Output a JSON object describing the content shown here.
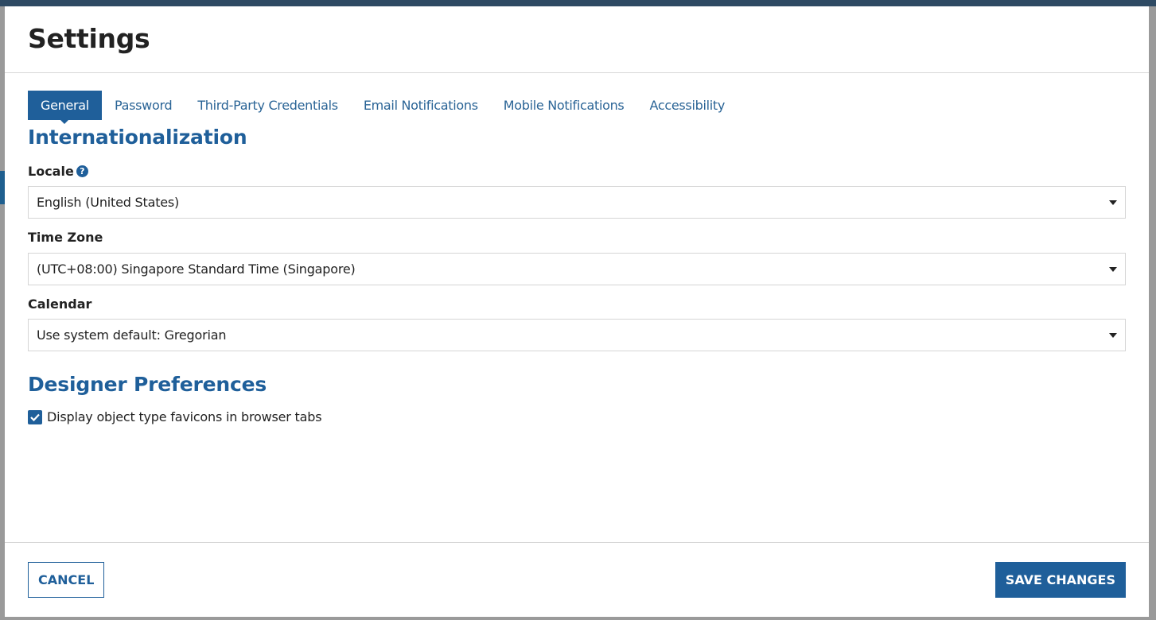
{
  "dialog": {
    "title": "Settings"
  },
  "tabs": [
    {
      "label": "General",
      "active": true
    },
    {
      "label": "Password",
      "active": false
    },
    {
      "label": "Third-Party Credentials",
      "active": false
    },
    {
      "label": "Email Notifications",
      "active": false
    },
    {
      "label": "Mobile Notifications",
      "active": false
    },
    {
      "label": "Accessibility",
      "active": false
    }
  ],
  "internationalization": {
    "heading": "Internationalization",
    "locale": {
      "label": "Locale",
      "value": "English (United States)"
    },
    "time_zone": {
      "label": "Time Zone",
      "value": "(UTC+08:00) Singapore Standard Time (Singapore)"
    },
    "calendar": {
      "label": "Calendar",
      "value": "Use system default: Gregorian"
    }
  },
  "designer_preferences": {
    "heading": "Designer Preferences",
    "favicons": {
      "label": "Display object type favicons in browser tabs",
      "checked": true
    }
  },
  "footer": {
    "cancel_label": "CANCEL",
    "save_label": "SAVE CHANGES"
  },
  "colors": {
    "accent": "#1f5f9a",
    "topbar": "#2e4a63",
    "border": "#d7d7d7"
  }
}
